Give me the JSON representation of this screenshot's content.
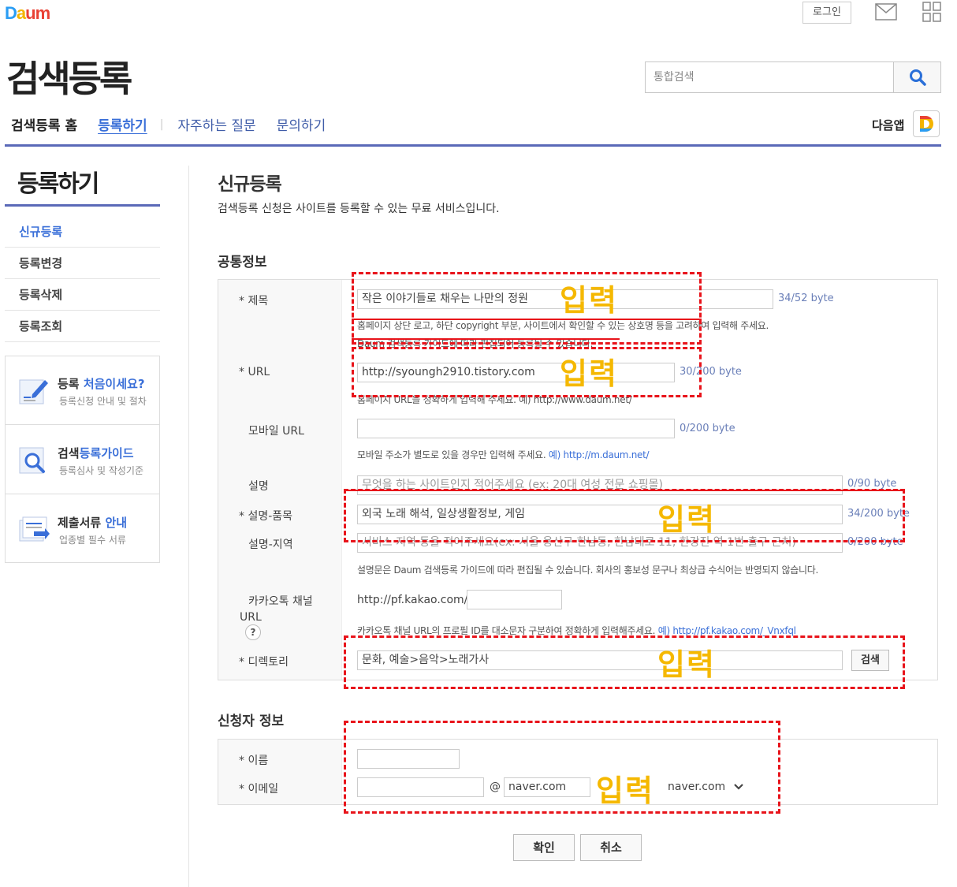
{
  "header": {
    "logo": "Daum",
    "login": "로그인",
    "mail_icon": "mail-icon",
    "grid_icon": "apps-grid-icon",
    "site_title": "검색등록",
    "search_placeholder": "통합검색",
    "search_icon": "search-icon"
  },
  "nav": {
    "home": "검색등록 홈",
    "register": "등록하기",
    "faq": "자주하는 질문",
    "inquiry": "문의하기",
    "app_label": "다음앱"
  },
  "sidebar": {
    "title": "등록하기",
    "items": [
      {
        "label": "신규등록"
      },
      {
        "label": "등록변경"
      },
      {
        "label": "등록삭제"
      },
      {
        "label": "등록조회"
      }
    ],
    "boxes": [
      {
        "title_plain": "등록 ",
        "title_accent": "처음이세요?",
        "sub": "등록신청 안내 및 절차"
      },
      {
        "title_plain": "검색",
        "title_accent": "등록가이드",
        "sub": "등록심사 및 작성기준"
      },
      {
        "title_plain": "제출서류 ",
        "title_accent": "안내",
        "sub": "업종별 필수 서류"
      }
    ]
  },
  "main": {
    "title": "신규등록",
    "desc": "검색등록 신청은 사이트를 등록할 수 있는 무료 서비스입니다.",
    "section_common": "공통정보",
    "section_applicant": "신청자 정보"
  },
  "form": {
    "title_label": "* 제목",
    "title_value": "작은 이야기들로 채우는 나만의 정원",
    "title_count": "34/52 byte",
    "title_help1": "홈페이지 상단 로고, 하단 copyright 부분, 사이트에서 확인할 수 있는 상호명 등을 고려하여 입력해 주세요.",
    "title_help2": "Daum 검색등록 가이드에 따라 편집되어 등록될 수 있습니다.",
    "url_label": "* URL",
    "url_value": "http://syoungh2910.tistory.com",
    "url_count": "30/200 byte",
    "url_help": "홈페이지 URL을 정확하게 입력해 주세요. 예) http://www.daum.net/",
    "mobile_label": "모바일 URL",
    "mobile_value": "",
    "mobile_count": "0/200 byte",
    "mobile_help": "모바일 주소가 별도로 있을 경우만 입력해 주세요.",
    "mobile_help_link": "예) http://m.daum.net/",
    "desc_label": "설명",
    "desc_placeholder": "무엇을 하는 사이트인지 적어주세요 (ex: 20대 여성 전문 쇼핑몰)",
    "desc_count": "0/90 byte",
    "item_label": "* 설명-품목",
    "item_value": "외국 노래 해석, 일상생활정보, 게임",
    "item_count": "34/200 byte",
    "region_label": "설명-지역",
    "region_placeholder": "서비스 지역 등을 적어주세요(ex: 서울 용산구 한남동, 한남대로 11, 한강진 역 1번 출구 근처)",
    "region_count": "0/200 byte",
    "desc_note": "설명문은 Daum 검색등록 가이드에 따라 편집될 수 있습니다. 회사의 홍보성 문구나 최상급 수식어는 반영되지 않습니다.",
    "kakao_label1": "카카오톡 채널",
    "kakao_label2": "URL",
    "kakao_prefix": "http://pf.kakao.com/",
    "kakao_help": "카카오톡 채널 URL의 프로필 ID를 대소문자 구분하여 정확하게 입력해주세요.",
    "kakao_help_link": "예) http://pf.kakao.com/_Vnxfql",
    "dir_label": "* 디렉토리",
    "dir_value": "문화, 예술>음악>노래가사",
    "dir_search": "검색",
    "name_label": "* 이름",
    "email_label": "* 이메일",
    "email_at": "@",
    "email_domain": "naver.com",
    "email_select": "naver.com",
    "ok": "확인",
    "cancel": "취소"
  },
  "annotation": {
    "input_text": "입력",
    "color": "#e8141b",
    "text_color": "#f5b800"
  }
}
